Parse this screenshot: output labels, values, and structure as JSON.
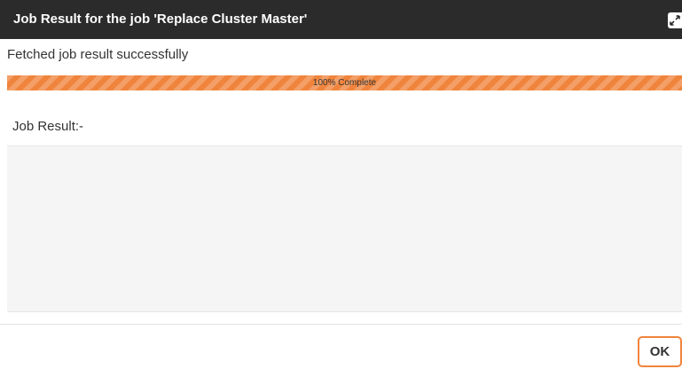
{
  "dialog": {
    "title": "Job Result for the job 'Replace Cluster Master'",
    "expand_icon": "expand-arrows-icon"
  },
  "status": {
    "message": "Fetched job result successfully"
  },
  "progress": {
    "value_percent": 100,
    "label": "100% Complete",
    "color": "#f0843c"
  },
  "result": {
    "label": "Job Result:-",
    "content": ""
  },
  "footer": {
    "ok_label": "OK"
  },
  "colors": {
    "titlebar_bg": "#2b2b2b",
    "accent": "#f0843c",
    "result_area_bg": "#f5f5f5"
  }
}
